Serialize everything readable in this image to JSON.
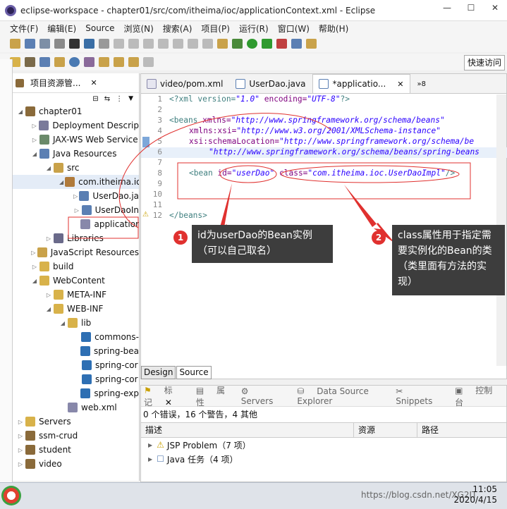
{
  "window": {
    "title": "eclipse-workspace - chapter01/src/com/itheima/ioc/applicationContext.xml - Eclipse",
    "min": "—",
    "max": "☐",
    "close": "✕"
  },
  "menu": [
    "文件(F)",
    "编辑(E)",
    "Source",
    "浏览(N)",
    "搜索(A)",
    "项目(P)",
    "运行(R)",
    "窗口(W)",
    "帮助(H)"
  ],
  "quick_access": "快速访问",
  "left_pane": {
    "title": "项目资源管...",
    "tree": [
      {
        "label": "chapter01",
        "level": 0,
        "icon": "project-icon"
      },
      {
        "label": "Deployment Descrip",
        "level": 1,
        "icon": "deployment-icon"
      },
      {
        "label": "JAX-WS Web Service",
        "level": 1,
        "icon": "webservice-icon"
      },
      {
        "label": "Java Resources",
        "level": 1,
        "icon": "java-resources-icon"
      },
      {
        "label": "src",
        "level": 2,
        "icon": "source-folder-icon"
      },
      {
        "label": "com.itheima.io",
        "level": 3,
        "icon": "package-icon"
      },
      {
        "label": "UserDao.ja",
        "level": 4,
        "icon": "java-file-icon"
      },
      {
        "label": "UserDaoIn",
        "level": 4,
        "icon": "java-file-icon"
      },
      {
        "label": "applicatior",
        "level": 4,
        "icon": "xml-file-icon"
      },
      {
        "label": "Libraries",
        "level": 2,
        "icon": "library-icon"
      },
      {
        "label": "JavaScript Resources",
        "level": 1,
        "icon": "js-resources-icon"
      },
      {
        "label": "build",
        "level": 1,
        "icon": "folder-icon"
      },
      {
        "label": "WebContent",
        "level": 1,
        "icon": "folder-icon"
      },
      {
        "label": "META-INF",
        "level": 2,
        "icon": "folder-icon"
      },
      {
        "label": "WEB-INF",
        "level": 2,
        "icon": "folder-icon"
      },
      {
        "label": "lib",
        "level": 3,
        "icon": "folder-icon"
      },
      {
        "label": "commons-",
        "level": 4,
        "icon": "jar-icon"
      },
      {
        "label": "spring-bea",
        "level": 4,
        "icon": "jar-icon"
      },
      {
        "label": "spring-cor",
        "level": 4,
        "icon": "jar-icon"
      },
      {
        "label": "spring-cor",
        "level": 4,
        "icon": "jar-icon"
      },
      {
        "label": "spring-exp",
        "level": 4,
        "icon": "jar-icon"
      },
      {
        "label": "web.xml",
        "level": 3,
        "icon": "xml-file-icon"
      },
      {
        "label": "Servers",
        "level": 0,
        "icon": "folder-icon"
      },
      {
        "label": "ssm-crud",
        "level": 0,
        "icon": "project-icon"
      },
      {
        "label": "student",
        "level": 0,
        "icon": "project-icon"
      },
      {
        "label": "video",
        "level": 0,
        "icon": "project-icon"
      }
    ]
  },
  "editor": {
    "tabs": [
      {
        "label": "video/pom.xml",
        "active": false
      },
      {
        "label": "UserDao.java",
        "active": false
      },
      {
        "label": "*applicatio...",
        "active": true,
        "close": "✕"
      }
    ],
    "overflow": "»8",
    "line_numbers": [
      "1",
      "2",
      "3",
      "4",
      "5",
      "6",
      "7",
      "8",
      "9",
      "10",
      "11",
      "12"
    ],
    "lines": {
      "l1": [
        "<?xml version=",
        "\"1.0\"",
        " encoding=",
        "\"UTF-8\"",
        "?>"
      ],
      "l3": [
        "<beans ",
        "xmlns=",
        "\"http://www.springframework.org/schema/beans\""
      ],
      "l4": [
        "xmlns:xsi=",
        "\"http://www.w3.org/2001/XMLSchema-instance\""
      ],
      "l5": [
        "xsi:schemaLocation=",
        "\"http://www.springframework.org/schema/be"
      ],
      "l6": [
        "\"http://www.springframework.org/schema/beans/spring-beans"
      ],
      "l8": [
        "<bean ",
        "id=",
        "\"userDao\"",
        " class=",
        "\"com.itheima.ioc.UserDaoImpl\"",
        "/>"
      ],
      "l12": [
        "</beans>"
      ]
    },
    "mode_tabs": [
      "Design",
      "Source"
    ]
  },
  "bottom": {
    "tabs": [
      "标记",
      "属性",
      "Servers",
      "Data Source Explorer",
      "Snippets",
      "控制台"
    ],
    "summary": "0 个错误，16 个警告，4 其他",
    "columns": [
      "描述",
      "资源",
      "路径"
    ],
    "rows": [
      "JSP Problem（7 项）",
      "Java 任务（4 项）"
    ]
  },
  "annotations": {
    "a1": {
      "num": "1",
      "text1": "id为userDao的Bean实例",
      "text2": "（可以自己取名）"
    },
    "a2": {
      "num": "2",
      "text1": "class属性用于指定需",
      "text2": "要实例化的Bean的类",
      "text3": "（类里面有方法的实",
      "text4": "现）"
    }
  },
  "taskbar": {
    "time": "11:05",
    "date": "2020/4/15",
    "watermark": "https://blog.csdn.net/XG2IT"
  },
  "colors": {
    "callout_bg": "#3d3d3d",
    "badge": "#e0312f",
    "ellipse": "#e0312f"
  }
}
